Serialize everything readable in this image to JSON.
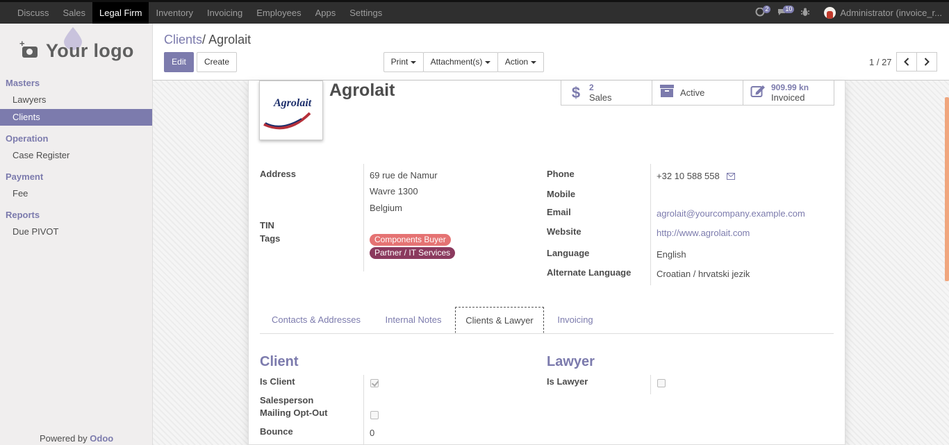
{
  "nav": {
    "menu": [
      "Discuss",
      "Sales",
      "Legal Firm",
      "Inventory",
      "Invoicing",
      "Employees",
      "Apps",
      "Settings"
    ],
    "active": "Legal Firm",
    "chat_count": "2",
    "messages_count": "10",
    "user": "Administrator (invoice_r..."
  },
  "sidebar": {
    "logo_text": "Your logo",
    "sections": {
      "masters": "Masters",
      "operation": "Operation",
      "payment": "Payment",
      "reports": "Reports"
    },
    "items": {
      "lawyers": "Lawyers",
      "clients": "Clients",
      "case_register": "Case Register",
      "fee": "Fee",
      "due_pivot": "Due PIVOT"
    },
    "powered_by": "Powered by",
    "powered_brand": "Odoo"
  },
  "control_panel": {
    "breadcrumb_parent": "Clients",
    "breadcrumb_sep": "/",
    "breadcrumb_current": "Agrolait",
    "edit": "Edit",
    "create": "Create",
    "print": "Print",
    "attachments": "Attachment(s)",
    "action": "Action",
    "pager": "1 / 27"
  },
  "record": {
    "name": "Agrolait",
    "logo_text": "Agrolait",
    "stats": {
      "sales_value": "2",
      "sales_label": "Sales",
      "active_label": "Active",
      "invoiced_value": "909.99 kn",
      "invoiced_label": "Invoiced"
    },
    "labels": {
      "address": "Address",
      "tin": "TIN",
      "tags": "Tags",
      "phone": "Phone",
      "mobile": "Mobile",
      "email": "Email",
      "website": "Website",
      "language": "Language",
      "alt_language": "Alternate Language"
    },
    "address": [
      "69 rue de Namur",
      "Wavre 1300",
      "Belgium"
    ],
    "tags": [
      "Components Buyer",
      "Partner / IT Services"
    ],
    "tag_colors": [
      "#e57373",
      "#8b3a5e"
    ],
    "phone": "+32 10 588 558",
    "email": "agrolait@yourcompany.example.com",
    "website": "http://www.agrolait.com",
    "language": "English",
    "alt_language": "Croatian / hrvatski jezik"
  },
  "tabs": [
    "Contacts & Addresses",
    "Internal Notes",
    "Clients & Lawyer",
    "Invoicing"
  ],
  "active_tab": "Clients & Lawyer",
  "client_section": {
    "title": "Client",
    "is_client_label": "Is Client",
    "is_client": true,
    "salesperson_label": "Salesperson",
    "mailing_label": "Mailing Opt-Out",
    "mailing_opt_out": false,
    "bounce_label": "Bounce",
    "bounce": "0"
  },
  "lawyer_section": {
    "title": "Lawyer",
    "is_lawyer_label": "Is Lawyer",
    "is_lawyer": false
  },
  "colors": {
    "accent": "#7c7bad",
    "navbar": "#2f2f2f"
  }
}
